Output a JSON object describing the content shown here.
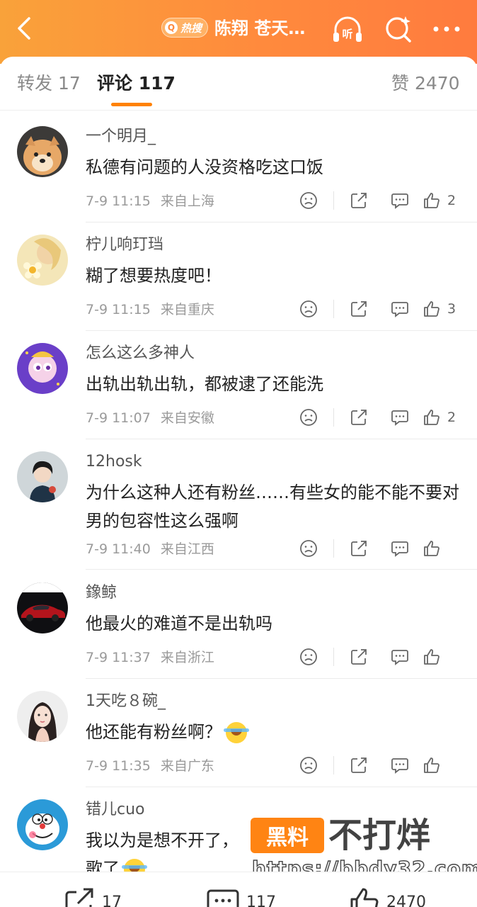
{
  "header": {
    "hot_badge": "热搜",
    "title": "陈翔 苍天…",
    "listen_label": "听"
  },
  "tabs": [
    {
      "label": "转发 17"
    },
    {
      "label": "评论 117"
    },
    {
      "label": "赞 2470"
    }
  ],
  "colors": {
    "accent": "#ff8200",
    "header_gradient_start": "#f9a23a",
    "header_gradient_end": "#ff7b3e"
  },
  "comments": [
    {
      "user": "一个明月_",
      "text": "私德有问题的人没资格吃这口饭",
      "time": "7-9 11:15",
      "location": "来自上海",
      "likes": "2"
    },
    {
      "user": "柠儿响玎珰",
      "text": "糊了想要热度吧！",
      "time": "7-9 11:15",
      "location": "来自重庆",
      "likes": "3"
    },
    {
      "user": "怎么这么多神人",
      "text": "出轨出轨出轨，都被逮了还能洗",
      "time": "7-9 11:07",
      "location": "来自安徽",
      "likes": "2"
    },
    {
      "user": "12hosk",
      "text": "为什么这种人还有粉丝……有些女的能不能不要对男的包容性这么强啊",
      "time": "7-9 11:40",
      "location": "来自江西",
      "likes": ""
    },
    {
      "user": "鐌鲸",
      "text": "他最火的难道不是出轨吗",
      "time": "7-9 11:37",
      "location": "来自浙江",
      "likes": ""
    },
    {
      "user": "1天吃８碗_",
      "text": "他还能有粉丝啊？",
      "time": "7-9 11:35",
      "location": "来自广东",
      "likes": ""
    },
    {
      "user": "错儿cuo",
      "text": "我以为是想不开了，",
      "text2": "歌了",
      "time": "",
      "location": "",
      "likes": ""
    }
  ],
  "watermark": {
    "logo": "黑料",
    "text": "不打烊",
    "url": "https://bbdy32.com"
  },
  "bottom_bar": {
    "repost_count": "17",
    "comment_count": "117",
    "like_count": "2470"
  }
}
